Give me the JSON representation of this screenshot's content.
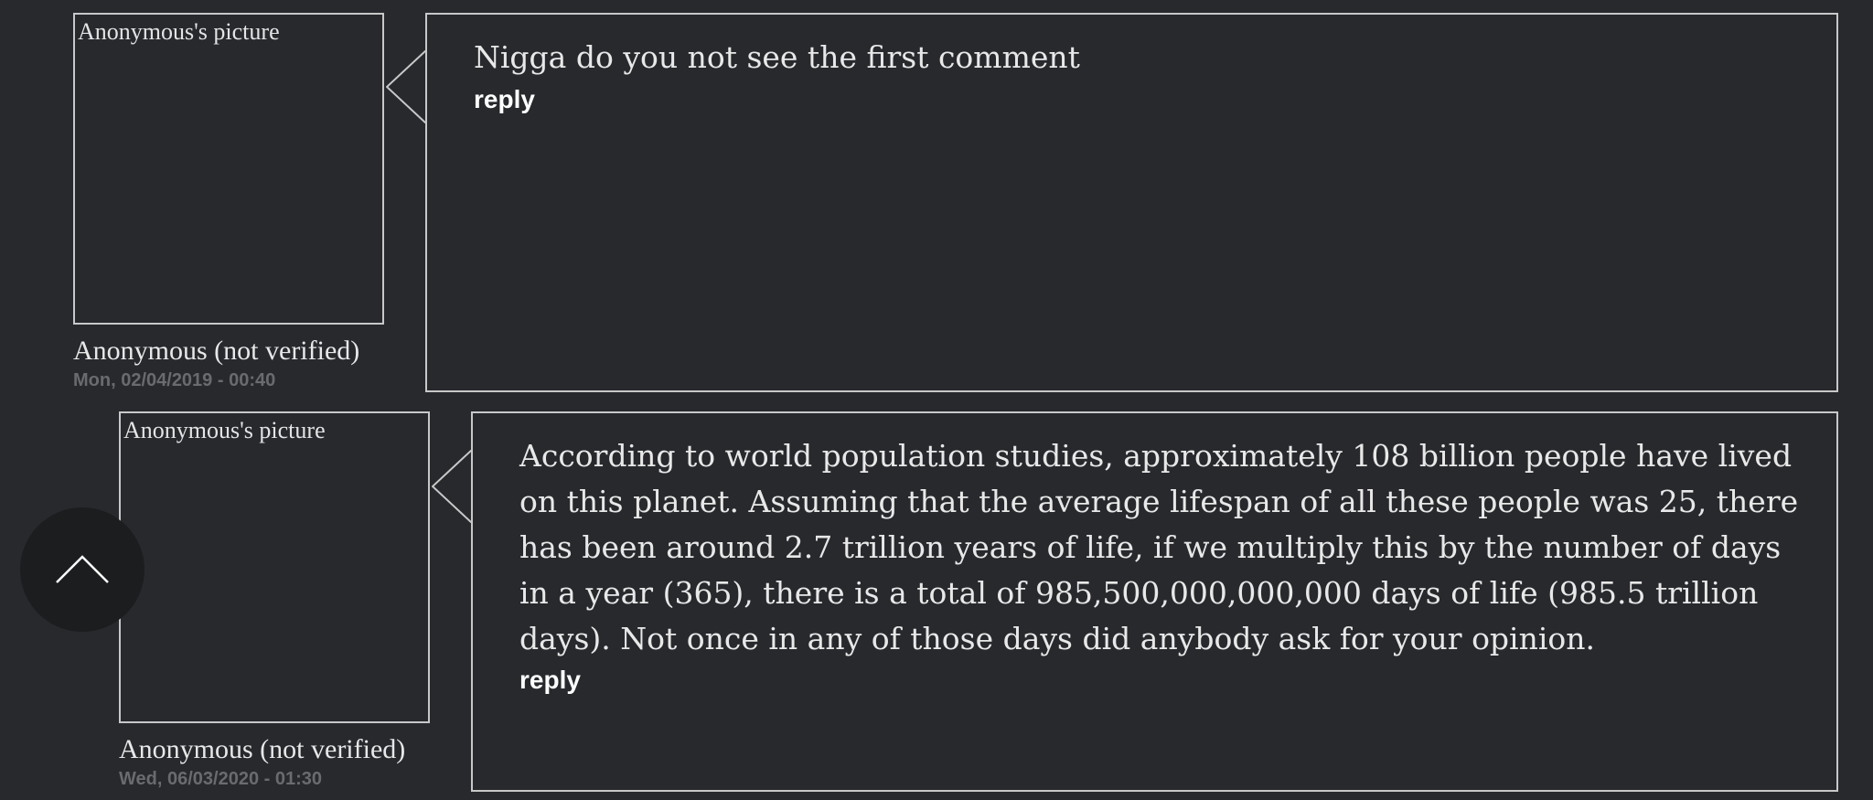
{
  "comments": [
    {
      "avatar_alt": "Anonymous's picture",
      "author": "Anonymous (not verified)",
      "date": "Mon, 02/04/2019 - 00:40",
      "body": "Nigga do you not see the first comment",
      "reply_label": "reply"
    },
    {
      "avatar_alt": "Anonymous's picture",
      "author": "Anonymous (not verified)",
      "date": "Wed, 06/03/2020 - 01:30",
      "body": "According to world population studies, approximately 108 billion people have lived on this planet. Assuming that the average lifespan of all these people was 25, there has been around 2.7 trillion years of life, if we multiply this by the number of days in a year (365), there is a total of 985,500,000,000,000 days of life (985.5 trillion days). Not once in any of those days did anybody ask for your opinion.",
      "reply_label": "reply"
    }
  ],
  "back_to_top": {
    "icon": "chevron-up-icon"
  },
  "colors": {
    "background": "#27292d",
    "border": "#c8c8c8",
    "date_text": "#6a6b6e",
    "back_to_top_bg": "#1c1d1f"
  }
}
